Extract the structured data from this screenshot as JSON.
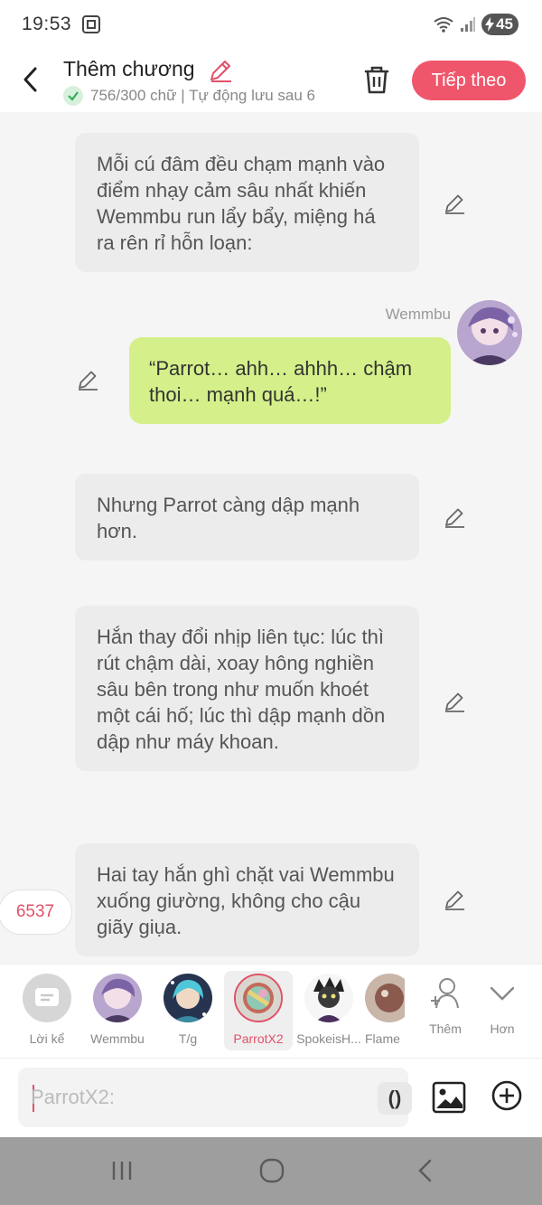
{
  "status_bar": {
    "time": "19:53",
    "battery": "45"
  },
  "header": {
    "title": "Thêm chương",
    "subtitle": "756/300 chữ | Tự động lưu sau 6",
    "next_label": "Tiếp theo"
  },
  "messages": [
    {
      "type": "narration",
      "text": "Mỗi cú đâm đều chạm mạnh vào điểm nhạy cảm sâu nhất khiến Wemmbu run lẩy bẩy, miệng há ra rên rỉ hỗn loạn:"
    },
    {
      "type": "character",
      "sender": "Wemmbu",
      "text": "“Parrot… ahh… ahhh… chậm thoi… mạnh quá…!”"
    },
    {
      "type": "narration",
      "text": "Nhưng Parrot càng dập mạnh hơn."
    },
    {
      "type": "narration",
      "text": "Hắn thay đổi nhịp liên tục: lúc thì rút chậm dài, xoay hông nghiền sâu bên trong như muốn khoét một cái hố; lúc thì dập mạnh dồn dập như máy khoan."
    },
    {
      "type": "narration",
      "text": "Hai tay hắn ghì chặt vai Wemmbu xuống giường, không cho cậu giãy giụa."
    }
  ],
  "counter": "6537",
  "characters": [
    {
      "label": "Lời kể"
    },
    {
      "label": "Wemmbu"
    },
    {
      "label": "T/g"
    },
    {
      "label": "ParrotX2",
      "selected": true
    },
    {
      "label": "SpokeisH..."
    },
    {
      "label": "Flame"
    }
  ],
  "char_actions": {
    "more_label": "Thêm",
    "less_label": "Hơn"
  },
  "input": {
    "placeholder": "ParrotX2:",
    "paren_label": "()"
  },
  "colors": {
    "accent": "#f0566b",
    "user_bubble": "#d5f08a",
    "narration_bubble": "#ececec"
  }
}
